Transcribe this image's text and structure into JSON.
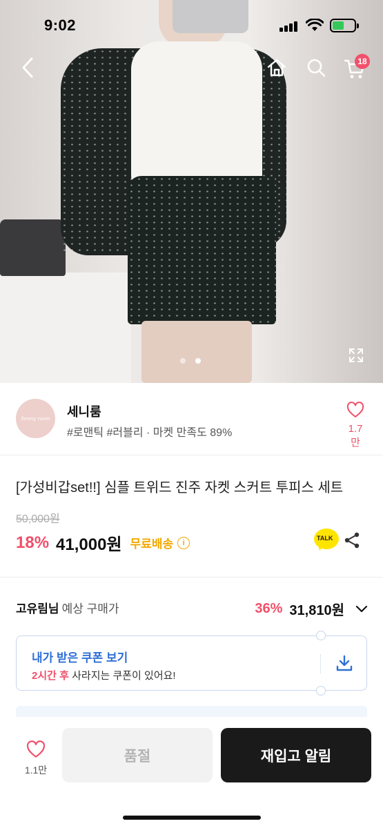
{
  "status_bar": {
    "time": "9:02"
  },
  "header": {
    "cart_count": "18"
  },
  "gallery": {
    "total": 2,
    "active_index": 1
  },
  "seller": {
    "avatar_text": "Senny room",
    "name": "세니룸",
    "tags": "#로맨틱 #러블리 · 마켓 만족도 89%",
    "like_count": "1.7만"
  },
  "product": {
    "title": "[가성비갑set!!] 심플 트위드 진주 자켓 스커트 투피스 세트",
    "original_price": "50,000원",
    "discount": "18%",
    "price": "41,000원",
    "shipping": "무료배송",
    "info_icon": "i",
    "talk_label": "TALK"
  },
  "expected": {
    "user": "고유림님",
    "label": "예상 구매가",
    "discount": "36%",
    "price": "31,810원"
  },
  "coupon": {
    "title": "내가 받은 쿠폰 보기",
    "highlight": "2시간 후",
    "desc": " 사라지는 쿠폰이 있어요!"
  },
  "bottom_bar": {
    "like_count": "1.1만",
    "soldout_label": "품절",
    "restock_label": "재입고 알림"
  },
  "colors": {
    "accent_pink": "#f0506a",
    "free_shipping": "#f2a900",
    "coupon_blue": "#2f6fd6",
    "cta_dark": "#1a1a1a"
  }
}
